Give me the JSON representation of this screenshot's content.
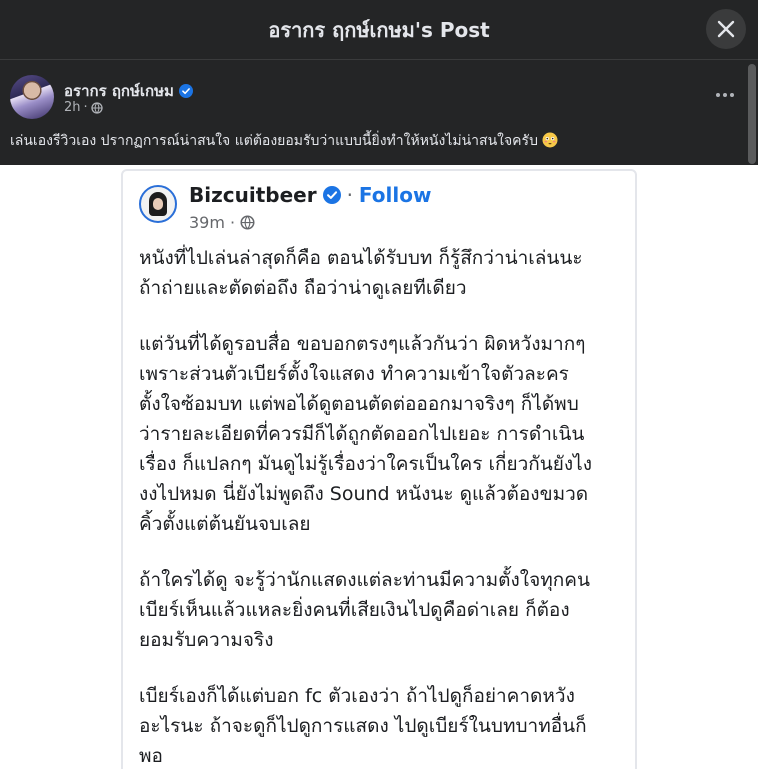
{
  "modal": {
    "title": "อรากร ฤกษ์เกษม's Post",
    "close_icon": "close-icon"
  },
  "post": {
    "author": "อรากร ฤกษ์เกษม",
    "time": "2h",
    "dot": "·",
    "audience_icon": "globe-icon",
    "caption": "เล่นเองรีวิวเอง ปรากฏการณ์น่าสนใจ แต่ต้องยอมรับว่าแบบนี้ยิ่งทำให้หนังไม่น่าสนใจครับ",
    "caption_emoji": "flushed-face-emoji"
  },
  "shared": {
    "name": "Bizcuitbeer",
    "dot": "·",
    "follow": "Follow",
    "time": "39m",
    "paragraphs": [
      [
        "หนังที่ไปเล่นล่าสุดก็คือ ตอนได้รับบท ก็รู้สึกว่าน่าเล่นนะ",
        "ถ้าถ่ายและตัดต่อถึง ถือว่าน่าดูเลยทีเดียว"
      ],
      [
        "แต่วันที่ได้ดูรอบสื่อ ขอบอกตรงๆแล้วกันว่า ผิดหวังมากๆ",
        "เพราะส่วนตัวเบียร์ตั้งใจแสดง ทำความเข้าใจตัวละคร",
        "ตั้งใจซ้อมบท แต่พอได้ดูตอนตัดต่อออกมาจริงๆ ก็ได้พบ",
        "ว่ารายละเอียดที่ควรมีก็ได้ถูกตัดออกไปเยอะ การดำเนิน",
        "เรื่อง ก็แปลกๆ มันดูไม่รู้เรื่องว่าใครเป็นใคร เกี่ยวกันยังไง",
        "งงไปหมด นี่ยังไม่พูดถึง Sound หนังนะ ดูแล้วต้องขมวด",
        "คิ้วตั้งแต่ต้นยันจบเลย"
      ],
      [
        "ถ้าใครได้ดู จะรู้ว่านักแสดงแต่ละท่านมีความตั้งใจทุกคน",
        "เบียร์เห็นแล้วแหละยิ่งคนที่เสียเงินไปดูคือด่าเลย ก็ต้อง",
        "ยอมรับความจริง"
      ],
      [
        "เบียร์เองก็ได้แต่บอก fc ตัวเองว่า ถ้าไปดูก็อย่าคาดหวัง",
        "อะไรนะ ถ้าจะดูก็ไปดูการแสดง ไปดูเบียร์ในบทบาทอื่นก็",
        "พอ"
      ]
    ]
  },
  "colors": {
    "background": "#242526",
    "text_primary": "#e4e6eb",
    "text_secondary": "#b0b3b8",
    "verified": "#1b74e4",
    "link": "#1b74e4"
  }
}
